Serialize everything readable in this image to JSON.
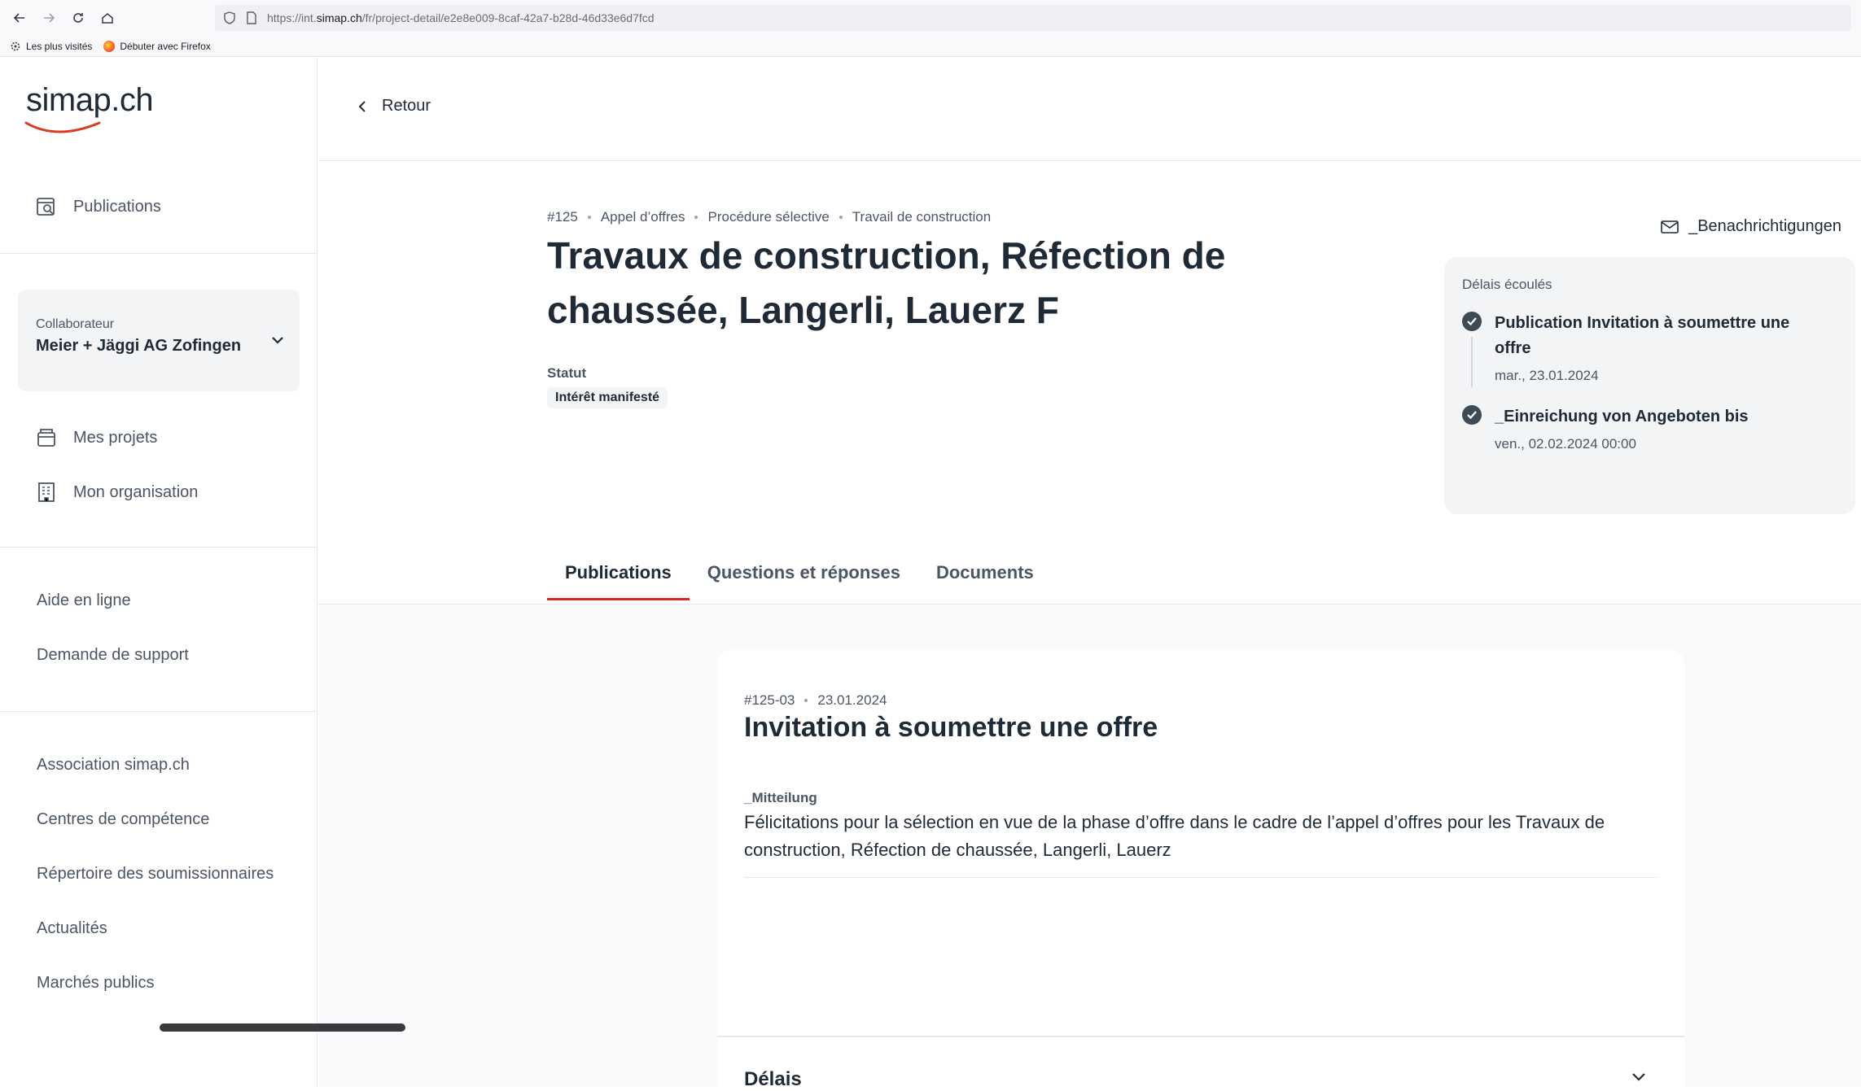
{
  "browser": {
    "url_prefix": "https://int.",
    "url_domain": "simap.ch",
    "url_path": "/fr/project-detail/e2e8e009-8caf-42a7-b28d-46d33e6d7fcd",
    "bookmarks": [
      "Les plus visités",
      "Débuter avec Firefox"
    ]
  },
  "sidebar": {
    "logo": "simap.ch",
    "publications": "Publications",
    "collaborator": {
      "label": "Collaborateur",
      "value": "Meier + Jäggi AG Zofingen"
    },
    "my_projects": "Mes projets",
    "my_organisation": "Mon organisation",
    "help_links": [
      "Aide en ligne",
      "Demande de support"
    ],
    "footer_links": [
      "Association simap.ch",
      "Centres de compétence",
      "Répertoire des soumissionnaires",
      "Actualités",
      "Marchés publics"
    ]
  },
  "header": {
    "back": "Retour"
  },
  "project": {
    "breadcrumb": [
      "#125",
      "Appel d’offres",
      "Procédure sélective",
      "Travail de construction"
    ],
    "title": "Travaux de construction, Réfection de chaussée, Langerli, Lauerz F",
    "status_label": "Statut",
    "status_value": "Intérêt manifesté",
    "notifications": "_Benachrichtigungen"
  },
  "deadlines": {
    "heading": "Délais écoulés",
    "items": [
      {
        "title": "Publication Invitation à soumettre une offre",
        "date": "mar., 23.01.2024"
      },
      {
        "title": "_Einreichung von Angeboten bis",
        "date": "ven., 02.02.2024 00:00"
      }
    ]
  },
  "tabs": [
    "Publications",
    "Questions et réponses",
    "Documents"
  ],
  "publication": {
    "id": "#125-03",
    "date": "23.01.2024",
    "title": "Invitation à soumettre une offre",
    "message_label": "_Mitteilung",
    "message": "Félicitations pour la sélection en vue de la phase d’offre dans le cadre de l’appel d’offres pour les Travaux de construction, Réfection de chaussée, Langerli, Lauerz",
    "section": "Délais"
  }
}
